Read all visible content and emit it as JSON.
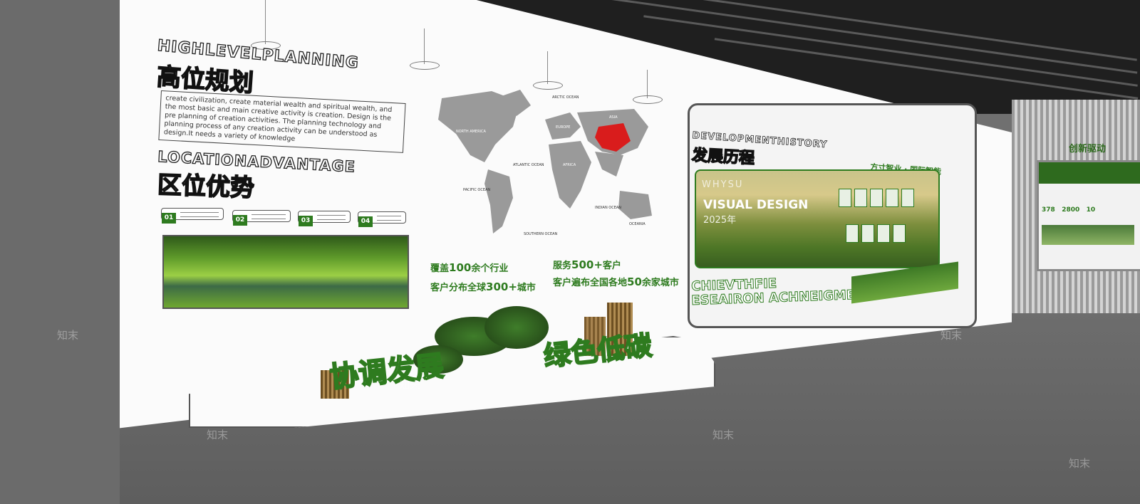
{
  "left_section": {
    "title_en": "HIGHLEVELPLANNING",
    "title_cn": "高位规划",
    "paragraph": "create civilization, create material wealth and spiritual wealth, and the most basic and main creative activity is creation. Design is the pre planning of creation activities. The planning technology and planning process of any creation activity can be understood as design.It needs a variety of knowledge",
    "subtitle_en": "LOCATIONADVANTAGE",
    "subtitle_cn": "区位优势",
    "pills": [
      "01",
      "02",
      "03",
      "04"
    ]
  },
  "map": {
    "label_arctic": "ARCTIC OCEAN",
    "label_atlantic": "ATLANTIC OCEAN",
    "label_pacific": "PACIFIC OCEAN",
    "label_indian": "INDIAN OCEAN",
    "label_southern": "SOUTHERN OCEAN",
    "label_oceania": "OCEANIA",
    "label_na": "NORTH AMERICA",
    "label_europe": "EUROPE",
    "label_asia": "ASIA",
    "label_africa": "AFRICA",
    "highlight_color": "#d91c1c"
  },
  "stats": {
    "s1_pre": "覆盖",
    "s1_num": "100",
    "s1_post": "余个行业",
    "s2_pre": "客户分布全球",
    "s2_num": "300+",
    "s2_post": "城市",
    "s3_pre": "服务",
    "s3_num": "500+",
    "s3_post": "客户",
    "s4_pre": "客户遍布全国各地",
    "s4_num": "50",
    "s4_post": "余家城市"
  },
  "history": {
    "title_en": "DEVELOPMENTHISTORY",
    "title_cn": "发展历程",
    "banner_small": "WHYSU",
    "banner_big": "VISUAL DESIGN",
    "banner_year": "2025年",
    "banner_right": "方寸智业 · 国际智能",
    "bottom_1": "CHIEVTHFIE",
    "bottom_2": "ESEAIRON ACHNEIGMEIT"
  },
  "slogan": {
    "part1": "协调发展",
    "part2": "绿色低碳"
  },
  "right_board": {
    "title": "创新驱动",
    "stat1": "378",
    "stat2": "2800",
    "stat3": "10"
  },
  "watermark": "知末",
  "colors": {
    "accent_green": "#2e7b1f",
    "wall": "#fbfbfb",
    "floor": "#666666"
  }
}
